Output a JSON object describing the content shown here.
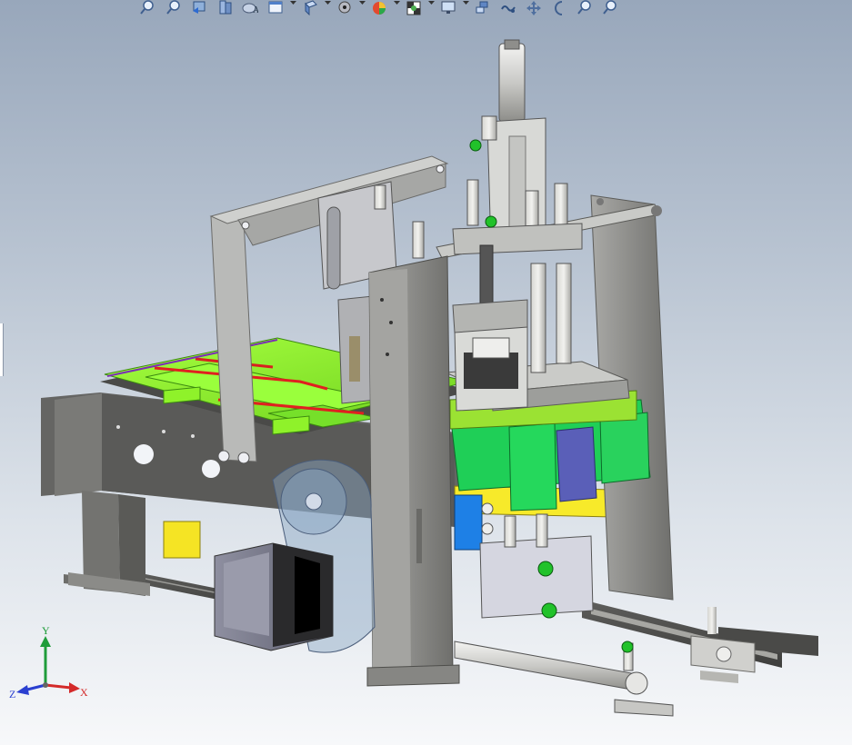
{
  "window": {
    "background_top": "#98a7bb",
    "background_bottom": "#f7f8fa"
  },
  "toolbar": {
    "icons": [
      {
        "name": "zoom-to-fit-icon",
        "dropdown": false
      },
      {
        "name": "zoom-to-area-icon",
        "dropdown": false
      },
      {
        "name": "previous-view-icon",
        "dropdown": false
      },
      {
        "name": "section-view-icon",
        "dropdown": false
      },
      {
        "name": "dynamic-annotation-icon",
        "dropdown": false
      },
      {
        "name": "view-orientation-icon",
        "dropdown": true
      },
      {
        "name": "display-style-icon",
        "dropdown": true
      },
      {
        "name": "hide-show-items-icon",
        "dropdown": true
      },
      {
        "name": "edit-appearance-icon",
        "dropdown": true
      },
      {
        "name": "apply-scene-icon",
        "dropdown": true
      },
      {
        "name": "view-settings-icon",
        "dropdown": true
      },
      {
        "name": "rotate-view-icon",
        "dropdown": false
      },
      {
        "name": "view-selector-icon",
        "dropdown": false
      },
      {
        "name": "pan-icon",
        "dropdown": false
      },
      {
        "name": "roll-view-icon",
        "dropdown": false
      },
      {
        "name": "zoom-in-out-icon",
        "dropdown": false
      },
      {
        "name": "zoom-to-selection-icon",
        "dropdown": false
      }
    ]
  },
  "triad": {
    "x_label": "X",
    "y_label": "Y",
    "z_label": "Z",
    "x_color": "#d42a2a",
    "y_color": "#1f9c3a",
    "z_color": "#2a3fd0"
  },
  "model": {
    "frame_color": "#8f8f8c",
    "plate_color": "#8ff22a",
    "motor_color": "#2e2e30",
    "block_green": "#21d155",
    "block_blue": "#5a5fb8",
    "accent_yellow": "#f0e21a",
    "accent_blue": "#1f78e0"
  }
}
